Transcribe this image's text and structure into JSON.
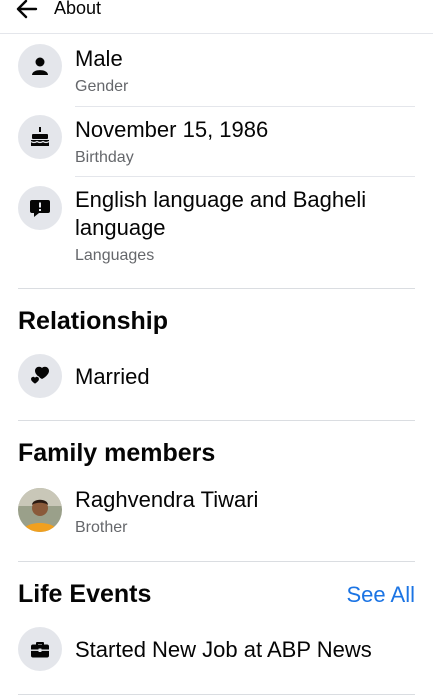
{
  "header": {
    "title": "About"
  },
  "basic_info": [
    {
      "value": "Male",
      "label": "Gender",
      "icon": "person-icon"
    },
    {
      "value": "November 15, 1986",
      "label": "Birthday",
      "icon": "birthday-cake-icon"
    },
    {
      "value_line1": "English language and Bagheli",
      "value_line2": "language",
      "label": "Languages",
      "icon": "speech-bubble-icon"
    }
  ],
  "relationship": {
    "title": "Relationship",
    "status": "Married",
    "icon": "hearts-icon"
  },
  "family": {
    "title": "Family members",
    "members": [
      {
        "name": "Raghvendra Tiwari",
        "relation": "Brother"
      }
    ]
  },
  "life_events": {
    "title": "Life Events",
    "see_all": "See All",
    "items": [
      {
        "text": "Started New Job at ABP News",
        "icon": "briefcase-icon"
      }
    ]
  },
  "colors": {
    "accent": "#1b74e4",
    "icon_bg": "#e4e6eb",
    "secondary_text": "#65676b"
  }
}
